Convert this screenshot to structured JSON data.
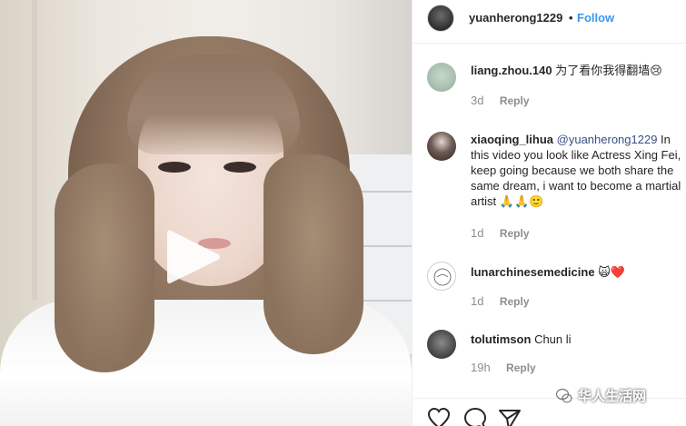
{
  "header": {
    "username": "yuanherong1229",
    "separator": "•",
    "follow_label": "Follow"
  },
  "comments": [
    {
      "username": "liang.zhou.140",
      "text": "为了看你我得翻墙😢",
      "time": "3d",
      "reply_label": "Reply"
    },
    {
      "username": "xiaoqing_lihua",
      "mention": "@yuanherong1229",
      "text": " In this video you look like Actress Xing Fei, keep going because we both share the same dream, i want to become a martial artist 🙏🙏🙂",
      "time": "1d",
      "reply_label": "Reply"
    },
    {
      "username": "lunarchinesemedicine",
      "text": "🙀❤️",
      "time": "1d",
      "reply_label": "Reply"
    },
    {
      "username": "tolutimson",
      "text": "Chun li",
      "time": "19h",
      "reply_label": "Reply"
    }
  ],
  "watermark": {
    "text": "华人生活网"
  },
  "icons": {
    "play": "play-icon",
    "like": "heart-icon",
    "comment": "comment-icon",
    "share": "share-icon",
    "watermark": "wechat-icon"
  },
  "colors": {
    "accent": "#3897f0",
    "mention": "#385185",
    "muted": "#8e8e8e",
    "text": "#262626"
  }
}
